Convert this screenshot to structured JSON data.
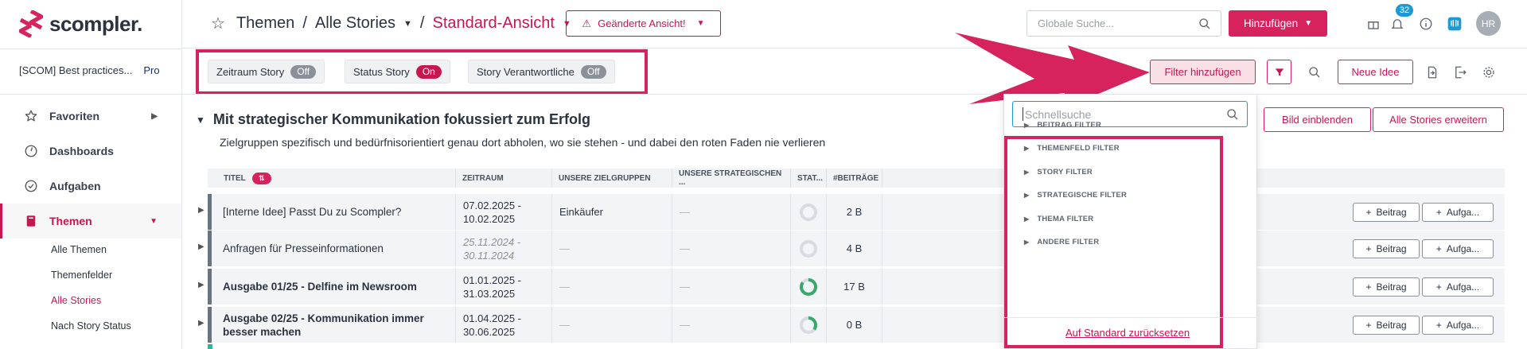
{
  "app": {
    "brand": "scompler.",
    "workspace": "[SCOM] Best practices...",
    "plan": "Pro"
  },
  "sidebar": {
    "items": [
      {
        "label": "Favoriten",
        "icon": "star-icon"
      },
      {
        "label": "Dashboards",
        "icon": "dashboard-icon"
      },
      {
        "label": "Aufgaben",
        "icon": "check-circle-icon"
      },
      {
        "label": "Themen",
        "icon": "book-icon"
      }
    ],
    "sub_items": [
      "Alle Themen",
      "Themenfelder",
      "Alle Stories",
      "Nach Story Status"
    ],
    "active_sub": "Alle Stories"
  },
  "header": {
    "crumb_1": "Themen",
    "crumb_2": "Alle Stories",
    "crumb_3": "Standard-Ansicht",
    "sep": "/",
    "changed_view": "Geänderte Ansicht!",
    "search_placeholder": "Globale Suche...",
    "add_label": "Hinzufügen",
    "notifications": "32",
    "avatar": "HR"
  },
  "toggles": [
    {
      "label": "Zeitraum Story",
      "state": "Off"
    },
    {
      "label": "Status Story",
      "state": "On"
    },
    {
      "label": "Story Verantwortliche",
      "state": "Off"
    }
  ],
  "toolbar": {
    "filter_add": "Filter hinzufügen",
    "new_idea": "Neue Idee",
    "show_image": "Bild einblenden",
    "expand_all": "Alle Stories erweitern"
  },
  "section": {
    "title": "Mit strategischer Kommunikation fokussiert zum Erfolg",
    "subtitle": "Zielgruppen spezifisch und bedürfnisorientiert genau dort abholen, wo sie stehen - und dabei den roten Faden nie verlieren"
  },
  "table": {
    "columns": [
      "TITEL",
      "ZEITRAUM",
      "UNSERE ZIELGRUPPEN",
      "UNSERE STRATEGISCHEN ...",
      "STAT...",
      "#BEITRÄGE"
    ],
    "rows": [
      {
        "title": "[Interne Idee] Passt Du zu Scompler?",
        "period_1": "07.02.2025 -",
        "period_2": "10.02.2025",
        "target": "Einkäufer",
        "strategic": "—",
        "status_progress": 0,
        "posts": "2 B",
        "bold": false,
        "italic": false
      },
      {
        "title": "Anfragen für Presseinformationen",
        "period_1": "25.11.2024 -",
        "period_2": "30.11.2024",
        "target": "—",
        "strategic": "—",
        "status_progress": 0,
        "posts": "4 B",
        "bold": false,
        "italic": true
      },
      {
        "title": "Ausgabe 01/25 - Delfine im Newsroom",
        "period_1": "01.01.2025 -",
        "period_2": "31.03.2025",
        "target": "—",
        "strategic": "—",
        "status_progress": 0.85,
        "posts": "17 B",
        "bold": true,
        "italic": false
      },
      {
        "title": "Ausgabe 02/25 - Kommunikation immer besser machen",
        "period_1": "01.04.2025 -",
        "period_2": "30.06.2025",
        "target": "—",
        "strategic": "—",
        "status_progress": 0.35,
        "posts": "0 B",
        "bold": true,
        "italic": false
      }
    ],
    "row_btn_post": "Beitrag",
    "row_btn_task": "Aufga..."
  },
  "dropdown": {
    "search_placeholder": "Schnellsuche",
    "groups": [
      "BEITRAG FILTER",
      "THEMENFELD FILTER",
      "STORY FILTER",
      "STRATEGISCHE FILTER",
      "THEMA FILTER",
      "ANDERE FILTER"
    ],
    "reset": "Auf Standard zurücksetzen"
  },
  "colors": {
    "brand": "#d6235d",
    "accent_blue": "#1b9ad6",
    "progress_green": "#3aa76d"
  }
}
